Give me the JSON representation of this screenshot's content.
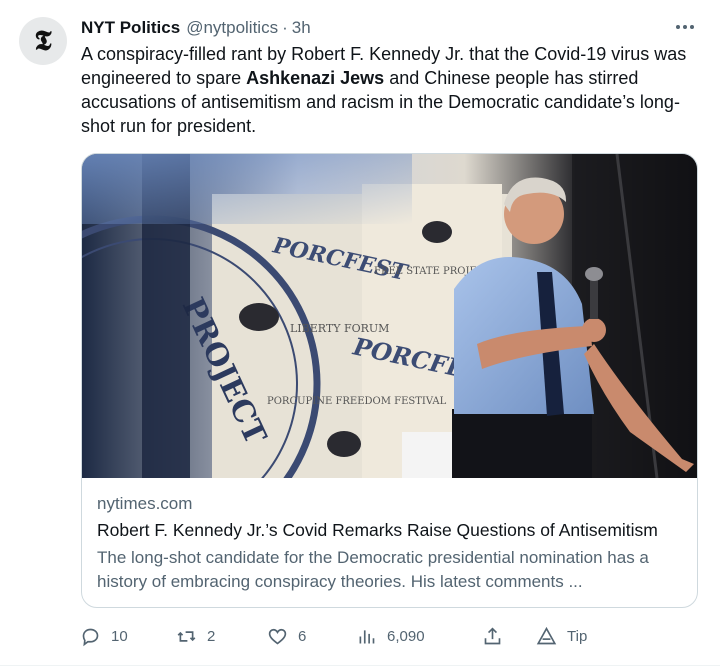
{
  "tweet": {
    "avatar_glyph": "𝕿",
    "author_name": "NYT Politics",
    "author_handle": "@nytpolitics",
    "separator": "·",
    "time": "3h",
    "text_part1": "A conspiracy-filled rant by Robert F. Kennedy Jr. that the Covid-19 virus was engineered to spare ",
    "text_bold": "Ashkenazi Jews",
    "text_part2": " and Chinese people has stirred accusations of antisemitism and racism in the Democratic candidate’s long-shot run for president."
  },
  "card": {
    "domain": "nytimes.com",
    "title": "Robert F. Kennedy Jr.’s Covid Remarks Raise Questions of Antisemitism",
    "description": "The long-shot candidate for the Democratic presidential nomination has a history of embracing conspiracy theories. His latest comments ...",
    "image_text": {
      "seal": "PROJECT",
      "porcfest": "PORCFEST",
      "liberty_forum": "LIBERTY FORUM",
      "porcupine_freedom_festival": "PORCUPINE FREEDOM FESTIVAL",
      "free_state_project": "FREE STATE PROJECT"
    }
  },
  "actions": {
    "replies": "10",
    "retweets": "2",
    "likes": "6",
    "views": "6,090",
    "tip_label": "Tip"
  },
  "colors": {
    "text_primary": "#0f1419",
    "text_secondary": "#536471",
    "border": "#cfd9de"
  }
}
